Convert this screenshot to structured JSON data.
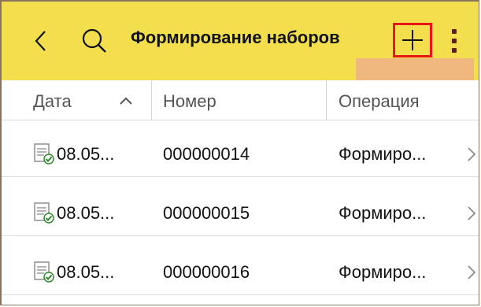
{
  "toolbar": {
    "title": "Формирование наборов",
    "icons": {
      "back": "chevron-left-icon",
      "search": "search-icon",
      "add": "plus-icon",
      "more": "more-vertical-icon"
    },
    "colors": {
      "background": "#f3df4e",
      "highlight_border": "#e81416"
    }
  },
  "table": {
    "columns": [
      {
        "label": "Дата",
        "sort": "ascending"
      },
      {
        "label": "Номер"
      },
      {
        "label": "Операция"
      }
    ],
    "rows": [
      {
        "date": "08.05...",
        "number": "000000014",
        "operation": "Формиро...",
        "status_icon": "document-posted-icon"
      },
      {
        "date": "08.05...",
        "number": "000000015",
        "operation": "Формиро...",
        "status_icon": "document-posted-icon"
      },
      {
        "date": "08.05...",
        "number": "000000016",
        "operation": "Формиро...",
        "status_icon": "document-posted-icon"
      }
    ]
  }
}
